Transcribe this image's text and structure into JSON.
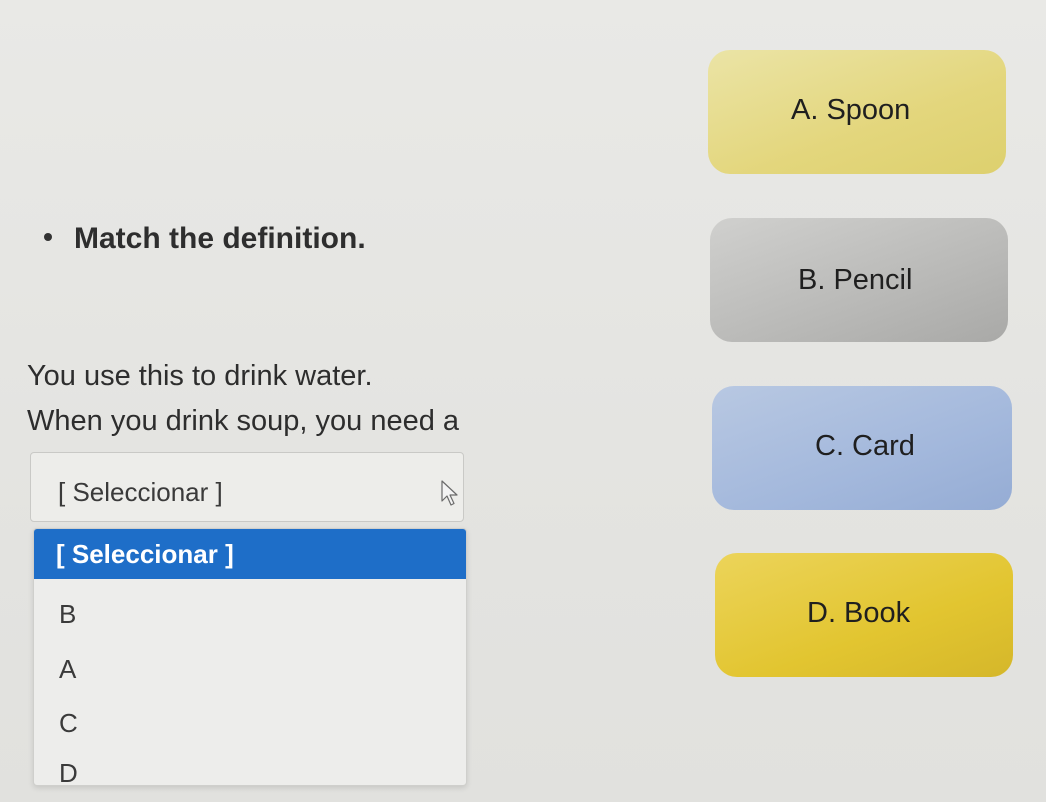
{
  "instruction": "Match the deﬁnition.",
  "questions": [
    "You use this to drink water.",
    "When you drink soup, you need a"
  ],
  "select": {
    "value": "[ Seleccionar ]"
  },
  "dropdown": {
    "options": [
      "[ Seleccionar ]",
      "B",
      "A",
      "C",
      "D"
    ],
    "highlight_color": "#1e6ec8"
  },
  "cards": [
    {
      "label": "A. Spoon",
      "color": "#e3d67c"
    },
    {
      "label": "B. Pencil",
      "color": "#b9b9b7"
    },
    {
      "label": "C. Card",
      "color": "#a3b8dc"
    },
    {
      "label": "D. Book",
      "color": "#e2c530"
    }
  ]
}
